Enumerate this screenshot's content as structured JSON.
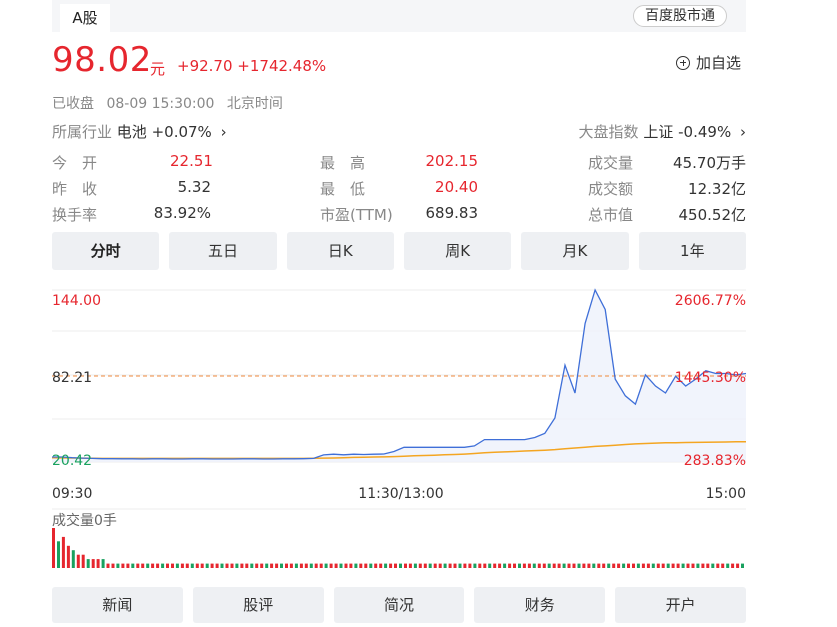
{
  "header": {
    "tab_label": "A股",
    "link_label": "百度股市通"
  },
  "quote": {
    "price": "98.02",
    "unit": "元",
    "change": "+92.70",
    "change_pct": "+1742.48%",
    "add_fav": "加自选",
    "status": "已收盘",
    "datetime": "08-09 15:30:00",
    "timezone": "北京时间"
  },
  "industry": {
    "label": "所属行业",
    "name": "电池",
    "change": "+0.07%"
  },
  "market": {
    "label": "大盘指数",
    "name": "上证",
    "change": "-0.49%"
  },
  "stats": [
    {
      "label": "今　开",
      "value": "22.51"
    },
    {
      "label": "最　高",
      "value": "202.15"
    },
    {
      "label": "成交量",
      "value": "45.70万手"
    },
    {
      "label": "昨　收",
      "value": "5.32"
    },
    {
      "label": "最　低",
      "value": "20.40"
    },
    {
      "label": "成交额",
      "value": "12.32亿"
    },
    {
      "label": "换手率",
      "value": "83.92%"
    },
    {
      "label": "市盈(TTM)",
      "value": "689.83"
    },
    {
      "label": "总市值",
      "value": "450.52亿"
    }
  ],
  "chart_tabs": [
    "分时",
    "五日",
    "日K",
    "周K",
    "月K",
    "1年"
  ],
  "chart_data": {
    "type": "line",
    "title": "",
    "x_ticks": [
      "09:30",
      "11:30/13:00",
      "15:00"
    ],
    "y_left_ticks": [
      "144.00",
      "82.21",
      "20.42"
    ],
    "y_right_ticks": [
      "2606.77%",
      "1445.30%",
      "283.83%"
    ],
    "ylim": [
      20.42,
      144.0
    ],
    "reference_price": 82.21,
    "series": [
      {
        "values": [
          24,
          24,
          23.5,
          23.2,
          23,
          22.8,
          22.8,
          22.7,
          22.7,
          22.6,
          22.7,
          22.7,
          22.6,
          22.6,
          22.7,
          22.7,
          22.6,
          22.6,
          22.6,
          22.7,
          22.7,
          22.6,
          22.6,
          22.7,
          22.7,
          22.8,
          23,
          25.5,
          26,
          25.6,
          26,
          25.8,
          26,
          26.2,
          28,
          31,
          31,
          31,
          31,
          31,
          31,
          31,
          32,
          36.5,
          36.5,
          36.5,
          36.5,
          36.5,
          38,
          41,
          52,
          90,
          70,
          120,
          144,
          130,
          80,
          68,
          62,
          83,
          75,
          70,
          82,
          75,
          80,
          86,
          84,
          84,
          83,
          84
        ]
      },
      {
        "values": [
          23.5,
          23.4,
          23.3,
          23.2,
          23.1,
          23,
          23,
          23,
          23,
          23,
          23,
          23,
          23,
          23,
          23,
          23,
          23,
          23,
          23,
          23,
          23,
          23,
          23,
          23,
          23,
          23,
          23.1,
          23.2,
          23.3,
          23.5,
          23.7,
          23.9,
          24,
          24.1,
          24.3,
          24.6,
          24.9,
          25.1,
          25.3,
          25.6,
          25.8,
          26.1,
          26.5,
          27,
          27.4,
          27.7,
          28,
          28.3,
          28.6,
          28.9,
          29.3,
          30,
          30.5,
          31,
          31.6,
          32,
          32.5,
          33,
          33.4,
          33.7,
          34,
          34.2,
          34.3,
          34.4,
          34.5,
          34.6,
          34.7,
          34.8,
          34.9,
          35
        ]
      }
    ],
    "volume_label": "成交量0手",
    "volume": [
      9,
      6,
      7,
      5,
      4,
      3,
      3,
      2,
      2,
      2,
      2,
      1,
      1,
      1,
      1,
      1,
      1,
      1,
      1,
      1,
      1,
      1,
      1,
      1,
      1,
      1,
      1,
      1,
      1,
      1,
      1,
      1,
      1,
      1,
      1,
      1,
      1,
      1,
      1,
      1,
      1,
      1,
      1,
      1,
      1,
      1,
      1,
      1,
      1,
      1,
      1,
      1,
      1,
      1,
      1,
      1,
      1,
      1,
      1,
      1,
      1,
      1,
      1,
      1,
      1,
      1,
      1,
      1,
      1,
      1,
      1,
      1,
      1,
      1,
      1,
      1,
      1,
      1,
      1,
      1,
      1,
      1,
      1,
      1,
      1,
      1,
      1,
      1,
      1,
      1,
      1,
      1,
      1,
      1,
      1,
      1,
      1,
      1,
      1,
      1,
      1,
      1,
      1,
      1,
      1,
      1,
      1,
      1,
      1,
      1,
      1,
      1,
      1,
      1,
      1,
      1,
      1,
      1,
      1,
      1,
      1,
      1,
      1,
      1,
      1,
      1,
      1,
      1,
      1,
      1,
      1,
      1,
      1,
      1,
      1,
      1,
      1,
      1,
      1,
      1
    ]
  },
  "bottom_tabs": [
    "新闻",
    "股评",
    "简况",
    "财务",
    "开户"
  ],
  "colors": {
    "up": "#e6262e",
    "price_line": "#3f6fd8",
    "avg_line": "#f4a521",
    "down": "#19a15f"
  }
}
